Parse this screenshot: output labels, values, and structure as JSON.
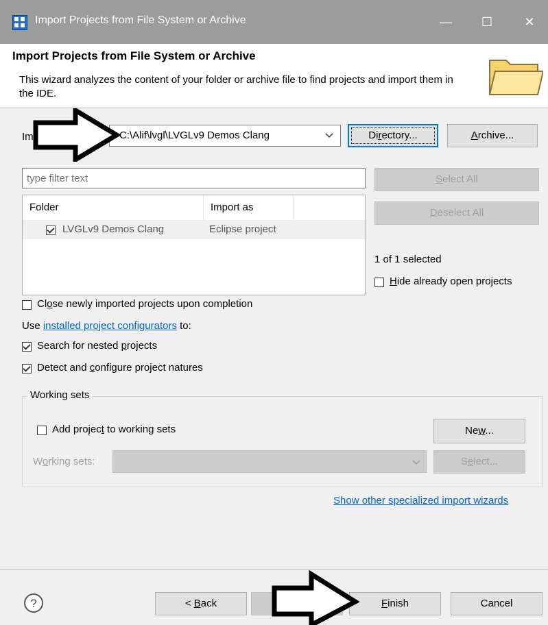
{
  "window": {
    "title": "Import Projects from File System or Archive",
    "controls": {
      "minimize": "—",
      "maximize": "☐",
      "close": "✕"
    }
  },
  "header": {
    "title": "Import Projects from File System or Archive",
    "description": "This wizard analyzes the content of your folder or archive file to find projects and import them in the IDE."
  },
  "source": {
    "label_partial": "Im",
    "path_value": "C:\\Alif\\lvgl\\LVGLv9 Demos Clang",
    "directory_button": {
      "pre": "Di",
      "u": "r",
      "post": "ectory..."
    },
    "archive_button": {
      "pre": "",
      "u": "A",
      "post": "rchive..."
    }
  },
  "filter": {
    "placeholder": "type filter text"
  },
  "table": {
    "columns": [
      "Folder",
      "Import as"
    ],
    "rows": [
      {
        "folder": "LVGLv9 Demos Clang",
        "import_as": "Eclipse project",
        "checked": true
      }
    ]
  },
  "side": {
    "select_all": {
      "pre": "",
      "u": "S",
      "post": "elect All"
    },
    "deselect_all": {
      "pre": "",
      "u": "D",
      "post": "eselect All"
    },
    "selection_count": "1 of 1 selected",
    "hide_open": {
      "pre": "",
      "u": "H",
      "post": "ide already open projects",
      "checked": false
    }
  },
  "options": {
    "close_projects": {
      "pre": "Cl",
      "u": "o",
      "post": "se newly imported projects upon completion",
      "checked": false
    },
    "use_prefix": "Use ",
    "configurators_link": "installed project configurators",
    "use_suffix": " to:",
    "search_nested": {
      "pre": "Search for nested ",
      "u": "p",
      "post": "rojects",
      "checked": true
    },
    "detect_natures": {
      "pre": "Detect and ",
      "u": "c",
      "post": "onfigure project natures",
      "checked": true
    }
  },
  "working_sets": {
    "legend": "Working sets",
    "add_checkbox": {
      "pre": "Add projec",
      "u": "t",
      "post": " to working sets",
      "checked": false
    },
    "new_button": {
      "pre": "Ne",
      "u": "w",
      "post": "..."
    },
    "sets_label": {
      "pre": "W",
      "u": "o",
      "post": "rking sets:"
    },
    "select_button": {
      "pre": "S",
      "u": "e",
      "post": "lect..."
    }
  },
  "other_wizards_link": "Show other specialized import wizards",
  "footer": {
    "help_icon": "?",
    "back_button": {
      "pre": "< ",
      "u": "B",
      "post": "ack"
    },
    "finish_button": {
      "pre": "",
      "u": "F",
      "post": "inish"
    },
    "cancel_button": "Cancel"
  },
  "colors": {
    "accent": "#0078d7",
    "link": "#0066cc",
    "titlebar": "#9c9c9c"
  }
}
